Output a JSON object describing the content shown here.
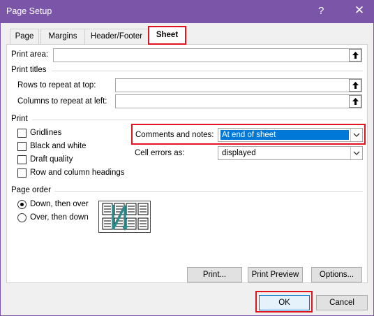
{
  "window": {
    "title": "Page Setup",
    "help_glyph": "?",
    "close_glyph": "✕"
  },
  "tabs": [
    {
      "label": "Page"
    },
    {
      "label": "Margins"
    },
    {
      "label": "Header/Footer"
    },
    {
      "label": "Sheet"
    }
  ],
  "active_tab": "Sheet",
  "print_area": {
    "label": "Print area:",
    "value": ""
  },
  "print_titles": {
    "heading": "Print titles",
    "rows_label": "Rows to repeat at top:",
    "rows_value": "",
    "columns_label": "Columns to repeat at left:",
    "columns_value": ""
  },
  "print": {
    "heading": "Print",
    "checkboxes": [
      {
        "label": "Gridlines",
        "checked": false
      },
      {
        "label": "Black and white",
        "checked": false
      },
      {
        "label": "Draft quality",
        "checked": false
      },
      {
        "label": "Row and column headings",
        "checked": false
      }
    ],
    "comments_label": "Comments and notes:",
    "comments_value": "At end of sheet",
    "errors_label": "Cell errors as:",
    "errors_value": "displayed"
  },
  "page_order": {
    "heading": "Page order",
    "options": [
      {
        "label": "Down, then over",
        "selected": true
      },
      {
        "label": "Over, then down",
        "selected": false
      }
    ]
  },
  "actions": {
    "print": "Print...",
    "print_preview": "Print Preview",
    "options": "Options..."
  },
  "footer": {
    "ok": "OK",
    "cancel": "Cancel"
  },
  "colors": {
    "title_bar": "#7b56a8",
    "highlight": "#e0141e",
    "selection": "#0078d7"
  },
  "icons": [
    "help-icon",
    "close-icon",
    "collapse-dialog-icon",
    "chevron-down-icon",
    "page-order-preview-icon"
  ]
}
